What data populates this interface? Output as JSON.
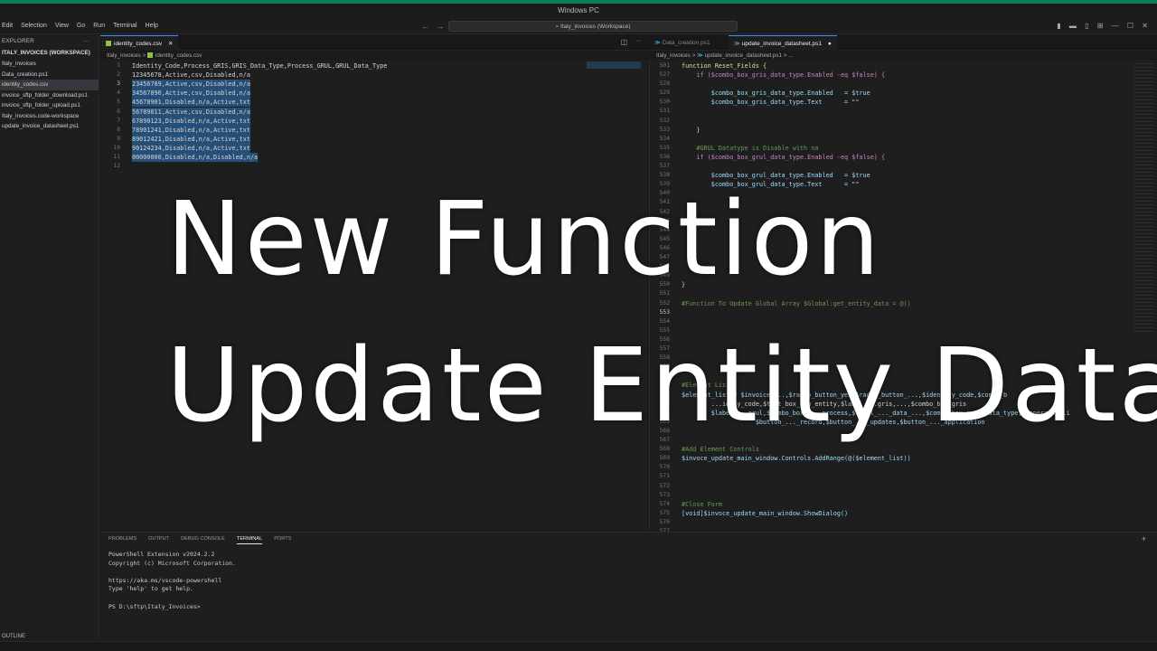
{
  "window": {
    "title": "Windows PC"
  },
  "menu": [
    "Edit",
    "Selection",
    "View",
    "Go",
    "Run",
    "Terminal",
    "Help"
  ],
  "search": {
    "text": "Italy_invoices (Workspace)"
  },
  "explorer": {
    "header": "EXPLORER",
    "workspace": "ITALY_INVOICES (WORKSPACE)",
    "folder": "Italy_invoices",
    "files": [
      "Data_creation.ps1",
      "identity_codes.csv",
      "invoice_sftp_folder_download.ps1",
      "invoice_sftp_folder_upload.ps1",
      "Italy_invoices.code-workspace",
      "update_invoice_datasheet.ps1"
    ],
    "selected_index": 1,
    "outline": "OUTLINE"
  },
  "left_editor": {
    "tab": "identity_codes.csv",
    "breadcrumb": [
      "Italy_invoices",
      "identity_codes.csv"
    ],
    "lines": [
      "Identity_Code,Process_GRIS,GRIS_Data_Type,Process_GRUL,GRUL_Data_Type",
      "12345678,Active,csv,Disabled,n/a",
      "23456789,Active,csv,Disabled,n/a",
      "34567890,Active,csv,Disabled,n/a",
      "45678901,Disabled,n/a,Active,txt",
      "56789011,Active,csv,Disabled,n/a",
      "67890123,Disabled,n/a,Active,txt",
      "78901241,Disabled,n/a,Active,txt",
      "89012421,Disabled,n/a,Active,txt",
      "90124234,Disabled,n/a,Active,txt",
      "00000000,Disabled,n/a,Disabled,n/a",
      ""
    ],
    "line_numbers": [
      "1",
      "2",
      "3",
      "4",
      "5",
      "6",
      "7",
      "8",
      "9",
      "10",
      "11",
      "12"
    ],
    "current_line": "3"
  },
  "right_editor": {
    "tabs": [
      "Data_creation.ps1",
      "update_invoice_datasheet.ps1"
    ],
    "breadcrumb": [
      "Italy_invoices",
      "update_invoice_datasheet.ps1",
      "..."
    ],
    "sticky": {
      "num": "501",
      "text": "function Reset_Fields {"
    },
    "lines": [
      {
        "n": "527",
        "t": "    if ($combo_box_gris_data_type.Enabled -eq $false) {"
      },
      {
        "n": "528",
        "t": ""
      },
      {
        "n": "529",
        "t": "        $combo_box_gris_data_type.Enabled   = $true"
      },
      {
        "n": "530",
        "t": "        $combo_box_gris_data_type.Text      = \"\""
      },
      {
        "n": "531",
        "t": ""
      },
      {
        "n": "532",
        "t": ""
      },
      {
        "n": "533",
        "t": "    }"
      },
      {
        "n": "534",
        "t": ""
      },
      {
        "n": "535",
        "t": "    #GRUL Datatype is Disable with na"
      },
      {
        "n": "536",
        "t": "    if ($combo_box_grul_data_type.Enabled -eq $false) {"
      },
      {
        "n": "537",
        "t": ""
      },
      {
        "n": "538",
        "t": "        $combo_box_grul_data_type.Enabled   = $true"
      },
      {
        "n": "539",
        "t": "        $combo_box_grul_data_type.Text      = \"\""
      },
      {
        "n": "540",
        "t": ""
      },
      {
        "n": "541",
        "t": ""
      },
      {
        "n": "542",
        "t": ""
      },
      {
        "n": "543",
        "t": "    }"
      },
      {
        "n": "544",
        "t": ""
      },
      {
        "n": "545",
        "t": ""
      },
      {
        "n": "546",
        "t": ""
      },
      {
        "n": "547",
        "t": ""
      },
      {
        "n": "548",
        "t": ""
      },
      {
        "n": "549",
        "t": ""
      },
      {
        "n": "550",
        "t": "}"
      },
      {
        "n": "551",
        "t": ""
      },
      {
        "n": "552",
        "t": "#Function To Update Global Array $Global:get_entity_data = @()"
      },
      {
        "n": "553",
        "t": ""
      },
      {
        "n": "554",
        "t": ""
      },
      {
        "n": "555",
        "t": ""
      },
      {
        "n": "556",
        "t": ""
      },
      {
        "n": "557",
        "t": ""
      },
      {
        "n": "558",
        "t": ""
      },
      {
        "n": "559",
        "t": ""
      },
      {
        "n": "560",
        "t": ""
      },
      {
        "n": "561",
        "t": "#Element List"
      },
      {
        "n": "562",
        "t": "$element_list = $invoice_...,$radio_button_yes,$radio_button_...,$identity_code,$combo_b"
      },
      {
        "n": "563",
        "t": "        ...idity_code,$text_box_new_entity,$label_...gris,...,$combo_box_gris"
      },
      {
        "n": "564",
        "t": "        $label_...grul,$combo_box_..._process,$label_..._data_...,$combo_box_grul_data_type,$seperator_li"
      },
      {
        "n": "565",
        "t": "                    $button_..._record,$button_..._updates,$button_..._application"
      },
      {
        "n": "566",
        "t": ""
      },
      {
        "n": "567",
        "t": ""
      },
      {
        "n": "568",
        "t": "#Add Element Controls"
      },
      {
        "n": "569",
        "t": "$invoce_update_main_window.Controls.AddRange(@($element_list))"
      },
      {
        "n": "570",
        "t": ""
      },
      {
        "n": "571",
        "t": ""
      },
      {
        "n": "572",
        "t": ""
      },
      {
        "n": "573",
        "t": ""
      },
      {
        "n": "574",
        "t": "#Close Form"
      },
      {
        "n": "575",
        "t": "[void]$invoce_update_main_window.ShowDialog()"
      },
      {
        "n": "576",
        "t": ""
      },
      {
        "n": "577",
        "t": ""
      }
    ],
    "current_line": "553"
  },
  "panel": {
    "tabs": [
      "PROBLEMS",
      "OUTPUT",
      "DEBUG CONSOLE",
      "TERMINAL",
      "PORTS"
    ],
    "active_tab_index": 3,
    "terminal": [
      "PowerShell Extension v2024.2.2",
      "Copyright (c) Microsoft Corporation.",
      "",
      "https://aka.ms/vscode-powershell",
      "Type 'help' to get help.",
      "",
      "PS D:\\sftp\\Italy_Invoices>"
    ]
  },
  "overlay": {
    "line1": "New Function",
    "line2": "Update Entity Data"
  },
  "colors": {
    "accent_bar": "#0d7d55",
    "selection": "#264f78",
    "tab_active_border": "#3794ff"
  }
}
